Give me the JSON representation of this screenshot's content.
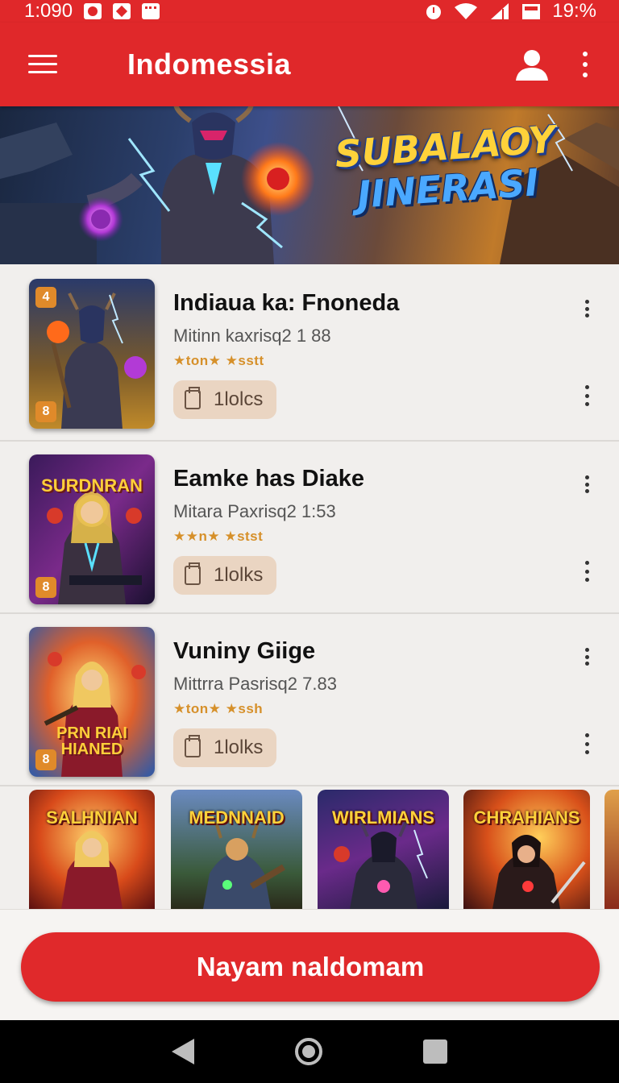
{
  "status_bar": {
    "time": "1:090",
    "battery": "19:%"
  },
  "app_bar": {
    "title": "Indomessia",
    "icons": [
      "menu-icon",
      "user-icon",
      "more-vert-icon"
    ]
  },
  "banner": {
    "line1": "SUBALAOY",
    "line2": "JINERASI"
  },
  "games": [
    {
      "title": "Indiaua ka: Fnoneda",
      "subtitle": "Mitinn kaxrisq2 1 88",
      "rating": "★ton★ ★sstt",
      "chip": "1lolcs",
      "badge_top": "4",
      "badge_bottom": "8",
      "thumb_text": ""
    },
    {
      "title": "Eamke has Diake",
      "subtitle": "Mitara Paxrisq2 1:53",
      "rating": "★★n★ ★stst",
      "chip": "1lolks",
      "badge_top": "",
      "badge_bottom": "8",
      "thumb_text": "SURDNRAN"
    },
    {
      "title": "Vuniny Giige",
      "subtitle": "Mittrra Pasrisq2 7.83",
      "rating": "★ton★ ★ssh",
      "chip": "1lolks",
      "badge_top": "",
      "badge_bottom": "8",
      "thumb_text": "PRN RIAI HIANED"
    }
  ],
  "carousel": [
    {
      "title": "SALHNIAN"
    },
    {
      "title": "MEDNNAID"
    },
    {
      "title": "WIRLMIANS"
    },
    {
      "title": "CHRAHIANS"
    }
  ],
  "cta": {
    "label": "Nayam naldomam"
  },
  "colors": {
    "primary": "#e0282a",
    "chip_bg": "#ead5c2",
    "rating": "#d6902a"
  }
}
